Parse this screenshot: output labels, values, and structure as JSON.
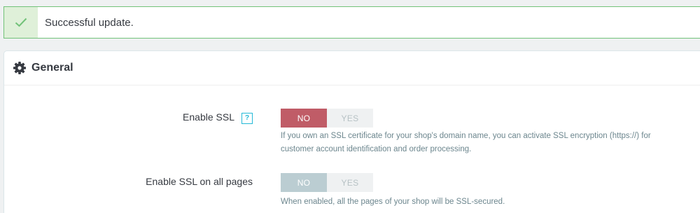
{
  "alert": {
    "message": "Successful update.",
    "icon": "check-icon",
    "color": "#72c279"
  },
  "panel": {
    "title": "General",
    "icon": "gear-icon"
  },
  "settings": [
    {
      "label": "Enable SSL",
      "help_badge": "?",
      "options": [
        "NO",
        "YES"
      ],
      "selected": "NO",
      "hint": "If you own an SSL certificate for your shop's domain name, you can activate SSL encryption (https://) for customer account identification and order processing."
    },
    {
      "label": "Enable SSL on all pages",
      "options": [
        "NO",
        "YES"
      ],
      "selected": "NO",
      "hint": "When enabled, all the pages of your shop will be SSL-secured."
    }
  ],
  "colors": {
    "success": "#72c279",
    "no_active": "#c05c67",
    "no_muted": "#bbcdd2",
    "info": "#25b9d7"
  }
}
